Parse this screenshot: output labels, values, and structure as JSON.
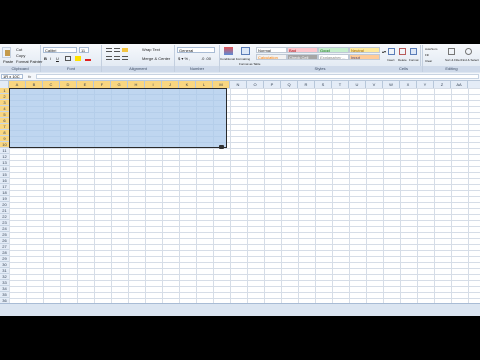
{
  "clipboard": {
    "paste": "Paste",
    "cut": "Cut",
    "copy": "Copy",
    "format_painter": "Format Painter",
    "group": "Clipboard"
  },
  "font": {
    "name": "Calibri",
    "size": "11",
    "group": "Font"
  },
  "alignment": {
    "wrap_text": "Wrap Text",
    "merge_center": "Merge & Center",
    "group": "Alignment"
  },
  "number": {
    "format": "General",
    "group": "Number"
  },
  "styles": {
    "conditional": "Conditional Formatting",
    "format_table": "Format as Table",
    "cells": [
      "Normal",
      "Bad",
      "Good",
      "Neutral",
      "Calculation",
      "Check Cell",
      "Explanatory ...",
      "Input"
    ],
    "group": "Styles"
  },
  "cells_group": {
    "insert": "Insert",
    "delete": "Delete",
    "format": "Format",
    "group": "Cells"
  },
  "editing": {
    "autosum": "AutoSum",
    "fill": "Fill",
    "clear": "Clear",
    "sort": "Sort & Filter",
    "find": "Find & Select",
    "group": "Editing"
  },
  "name_box": "1R x 10C",
  "fx": "fx",
  "columns": [
    "A",
    "B",
    "C",
    "D",
    "E",
    "F",
    "G",
    "H",
    "I",
    "J",
    "K",
    "L",
    "M",
    "N",
    "O",
    "P",
    "Q",
    "R",
    "S",
    "T",
    "U",
    "V",
    "W",
    "X",
    "Y",
    "Z",
    "AA"
  ],
  "rows": [
    "1",
    "2",
    "3",
    "4",
    "5",
    "6",
    "7",
    "8",
    "9",
    "10",
    "11",
    "12",
    "13",
    "14",
    "15",
    "16",
    "17",
    "18",
    "19",
    "20",
    "21",
    "22",
    "23",
    "24",
    "25",
    "26",
    "27",
    "28",
    "29",
    "30",
    "31",
    "32",
    "33",
    "34",
    "35",
    "36",
    "37"
  ]
}
